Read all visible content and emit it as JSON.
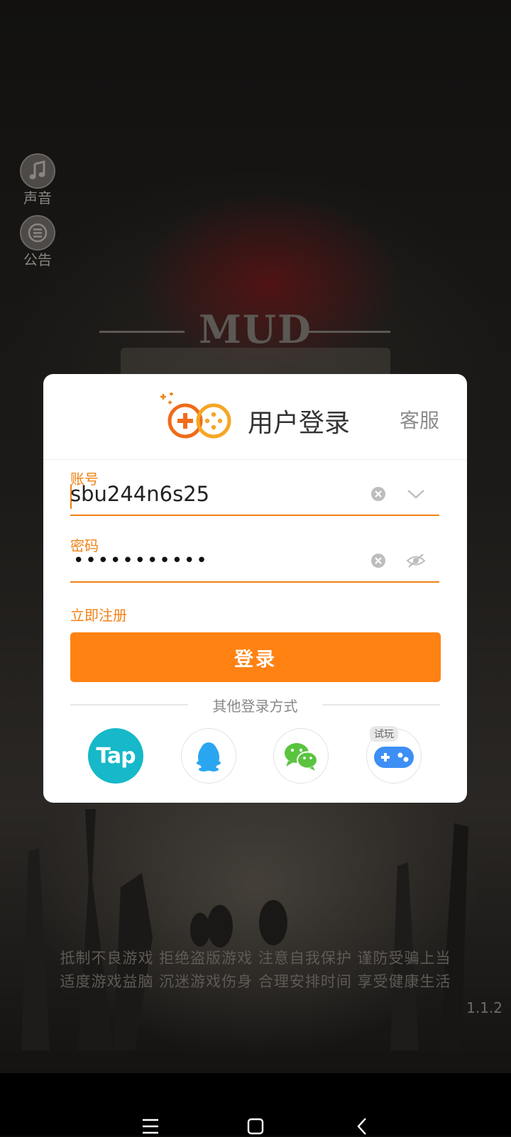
{
  "side": {
    "sound_label": "声音",
    "notice_label": "公告"
  },
  "background": {
    "title": "MUD"
  },
  "dialog": {
    "title": "用户登录",
    "service_label": "客服",
    "account": {
      "label": "账号",
      "value": "sbu244n6s25"
    },
    "password": {
      "label": "密码",
      "masked_value": "•••••••••••"
    },
    "register_label": "立即注册",
    "login_button": "登录",
    "other_methods_label": "其他登录方式",
    "social": {
      "tap_label": "Tap",
      "trial_tag": "试玩"
    }
  },
  "slogan": {
    "line1": "抵制不良游戏 拒绝盗版游戏 注意自我保护 谨防受骗上当",
    "line2": "适度游戏益脑 沉迷游戏伤身 合理安排时间 享受健康生活"
  },
  "version": "1.1.2",
  "colors": {
    "accent": "#ff8213",
    "field_accent": "#f08216",
    "tap_brand": "#16b8c9",
    "qq_blue": "#2aa6f0",
    "wechat_green": "#5ac43f",
    "trial_blue": "#3d8ff5"
  }
}
